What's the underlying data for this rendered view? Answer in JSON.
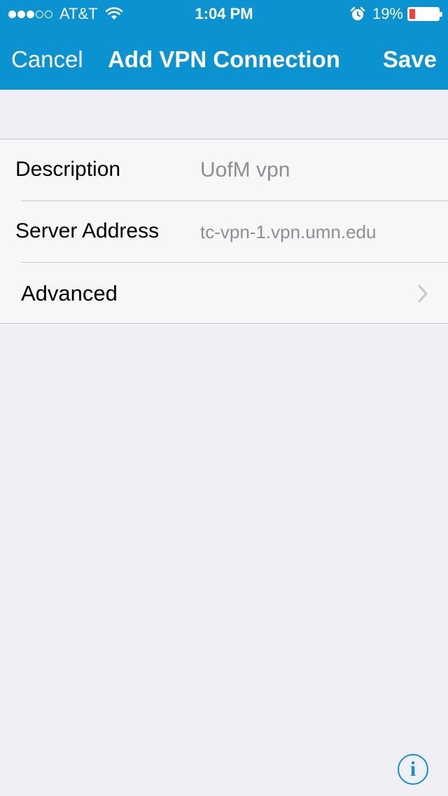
{
  "status_bar": {
    "signal_icon": "signal-strength-icon",
    "signal_bars_filled": 3,
    "signal_bars_total": 5,
    "carrier": "AT&T",
    "wifi_icon": "wifi-icon",
    "time": "1:04 PM",
    "alarm_icon": "alarm-clock-icon",
    "battery_percent": "19%",
    "battery_level": 0.19,
    "battery_color": "#ff3b30"
  },
  "nav": {
    "cancel_label": "Cancel",
    "title": "Add VPN Connection",
    "save_label": "Save",
    "background_color": "#0a92d1"
  },
  "form": {
    "description": {
      "label": "Description",
      "value": "UofM vpn"
    },
    "server_address": {
      "label": "Server Address",
      "value": "tc-vpn-1.vpn.umn.edu"
    },
    "advanced": {
      "label": "Advanced",
      "icon": "chevron-right-icon"
    }
  },
  "info_button": {
    "symbol": "i",
    "icon": "info-icon"
  }
}
